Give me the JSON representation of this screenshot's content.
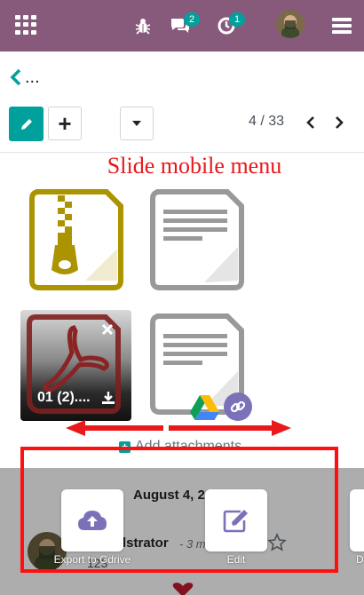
{
  "navbar": {
    "bg_color": "#875a7b",
    "apps_icon": "apps-grid-icon",
    "bug_icon": "bug-icon",
    "messages_icon": "chat-bubbles-icon",
    "messages_count": "2",
    "activities_icon": "clock-icon",
    "activities_count": "1",
    "avatar": "user-avatar",
    "menu_icon": "hamburger-menu-icon"
  },
  "breadcrumb": {
    "back_icon": "chevron-left-icon",
    "label": "..."
  },
  "control_panel": {
    "edit_icon": "pencil-icon",
    "add_label": "+",
    "dropdown_icon": "caret-down-icon",
    "pager": "4 / 33",
    "prev_icon": "chevron-left-icon",
    "next_icon": "chevron-right-icon",
    "accent_color": "#00a09d"
  },
  "annotation": {
    "title": "Slide mobile menu",
    "color": "#e8181b"
  },
  "attachments": {
    "items": [
      {
        "icon": "zip-file-icon",
        "color": "#ac9400"
      },
      {
        "icon": "text-file-icon",
        "color": "#999999"
      },
      {
        "icon": "pdf-file-icon",
        "name": "01 (2)....",
        "color": "#7f1f1f"
      },
      {
        "icon": "text-file-icon",
        "color": "#999999"
      }
    ],
    "add_label": "Add attachments"
  },
  "chatter": {
    "date": "August 4, 2",
    "author": "lstrator",
    "time": "- 3 m",
    "body": "123"
  },
  "swipe_actions": [
    {
      "icon": "cloud-upload-icon",
      "label": "Export to Gdrive"
    },
    {
      "icon": "edit-square-icon",
      "label": "Edit"
    },
    {
      "icon": "more-action-icon",
      "label": "D"
    }
  ]
}
